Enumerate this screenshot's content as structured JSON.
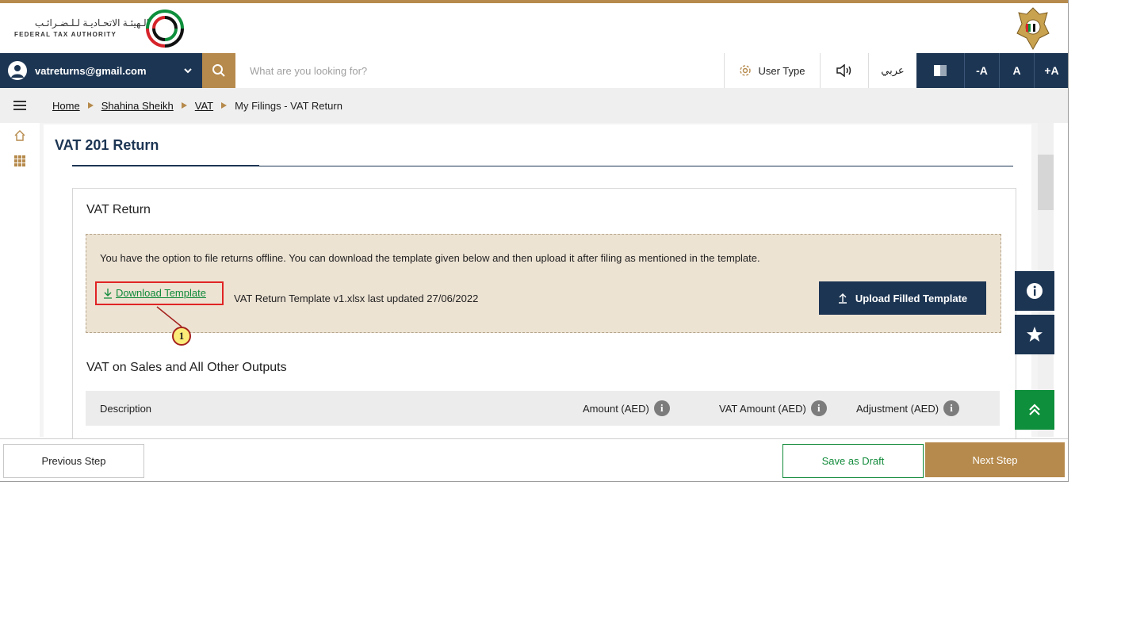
{
  "header": {
    "logo_arabic": "الـهيئـة الاتحـاديـة لـلـضـرائـب",
    "logo_english": "FEDERAL TAX AUTHORITY"
  },
  "navbar": {
    "user_email": "vatreturns@gmail.com",
    "search_placeholder": "What are you looking for?",
    "user_type_label": "User Type",
    "arabic_label": "عربي",
    "font_decrease": "-A",
    "font_normal": "A",
    "font_increase": "+A"
  },
  "breadcrumb": {
    "items": [
      "Home",
      "Shahina Sheikh",
      "VAT",
      "My Filings - VAT Return"
    ]
  },
  "page": {
    "title": "VAT 201 Return",
    "card_title": "VAT Return",
    "notice_text": "You have the option to file returns offline. You can download the template given below and then upload it after filing as mentioned in the template.",
    "download_label": "Download Template",
    "file_info": "VAT Return Template v1.xlsx last updated 27/06/2022",
    "upload_label": "Upload Filled Template",
    "callout_number": "1",
    "section_title": "VAT on Sales and All Other Outputs",
    "table_headers": {
      "description": "Description",
      "amount": "Amount (AED)",
      "vat_amount": "VAT Amount (AED)",
      "adjustment": "Adjustment (AED)"
    }
  },
  "footer": {
    "previous_label": "Previous Step",
    "draft_label": "Save as Draft",
    "next_label": "Next Step"
  },
  "colors": {
    "navy": "#1c3553",
    "gold": "#b68a4c",
    "green": "#0e8f3b",
    "notice_bg": "#ede3d3",
    "callout_red": "#e02424"
  }
}
